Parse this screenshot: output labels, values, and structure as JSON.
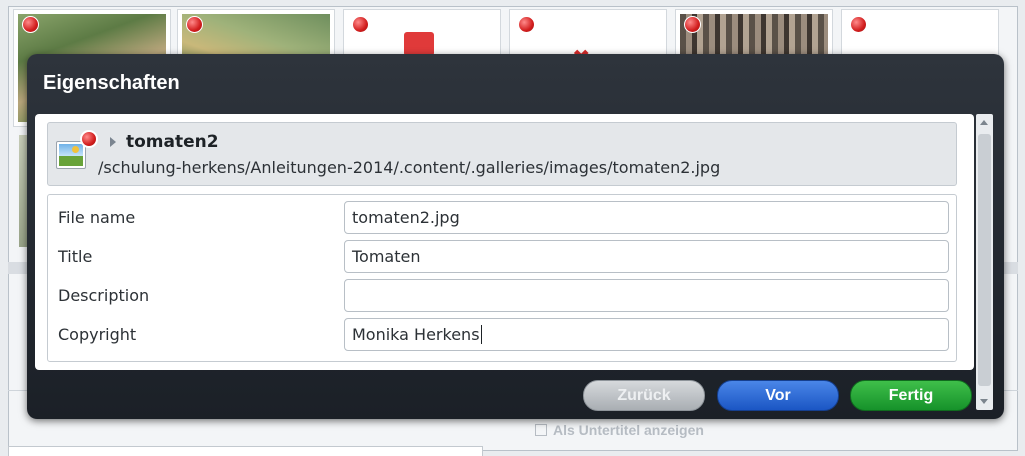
{
  "dialog": {
    "title": "Eigenschaften",
    "file": {
      "name": "tomaten2",
      "path": "/schulung-herkens/Anleitungen-2014/.content/.galleries/images/tomaten2.jpg",
      "icon": "image-file-icon",
      "status_color": "#d21e1e"
    },
    "properties": [
      {
        "label": "File name",
        "value": "tomaten2.jpg"
      },
      {
        "label": "Title",
        "value": "Tomaten"
      },
      {
        "label": "Description",
        "value": ""
      },
      {
        "label": "Copyright",
        "value": "Monika Herkens"
      }
    ],
    "buttons": {
      "back": "Zurück",
      "next": "Vor",
      "done": "Fertig"
    }
  },
  "background": {
    "checkbox_label": "Als Untertitel anzeigen"
  },
  "colors": {
    "dialog_header": "#1b2027",
    "next_button": "#1b56c4",
    "done_button": "#16922a",
    "back_button_disabled": "#a9aeb3"
  }
}
